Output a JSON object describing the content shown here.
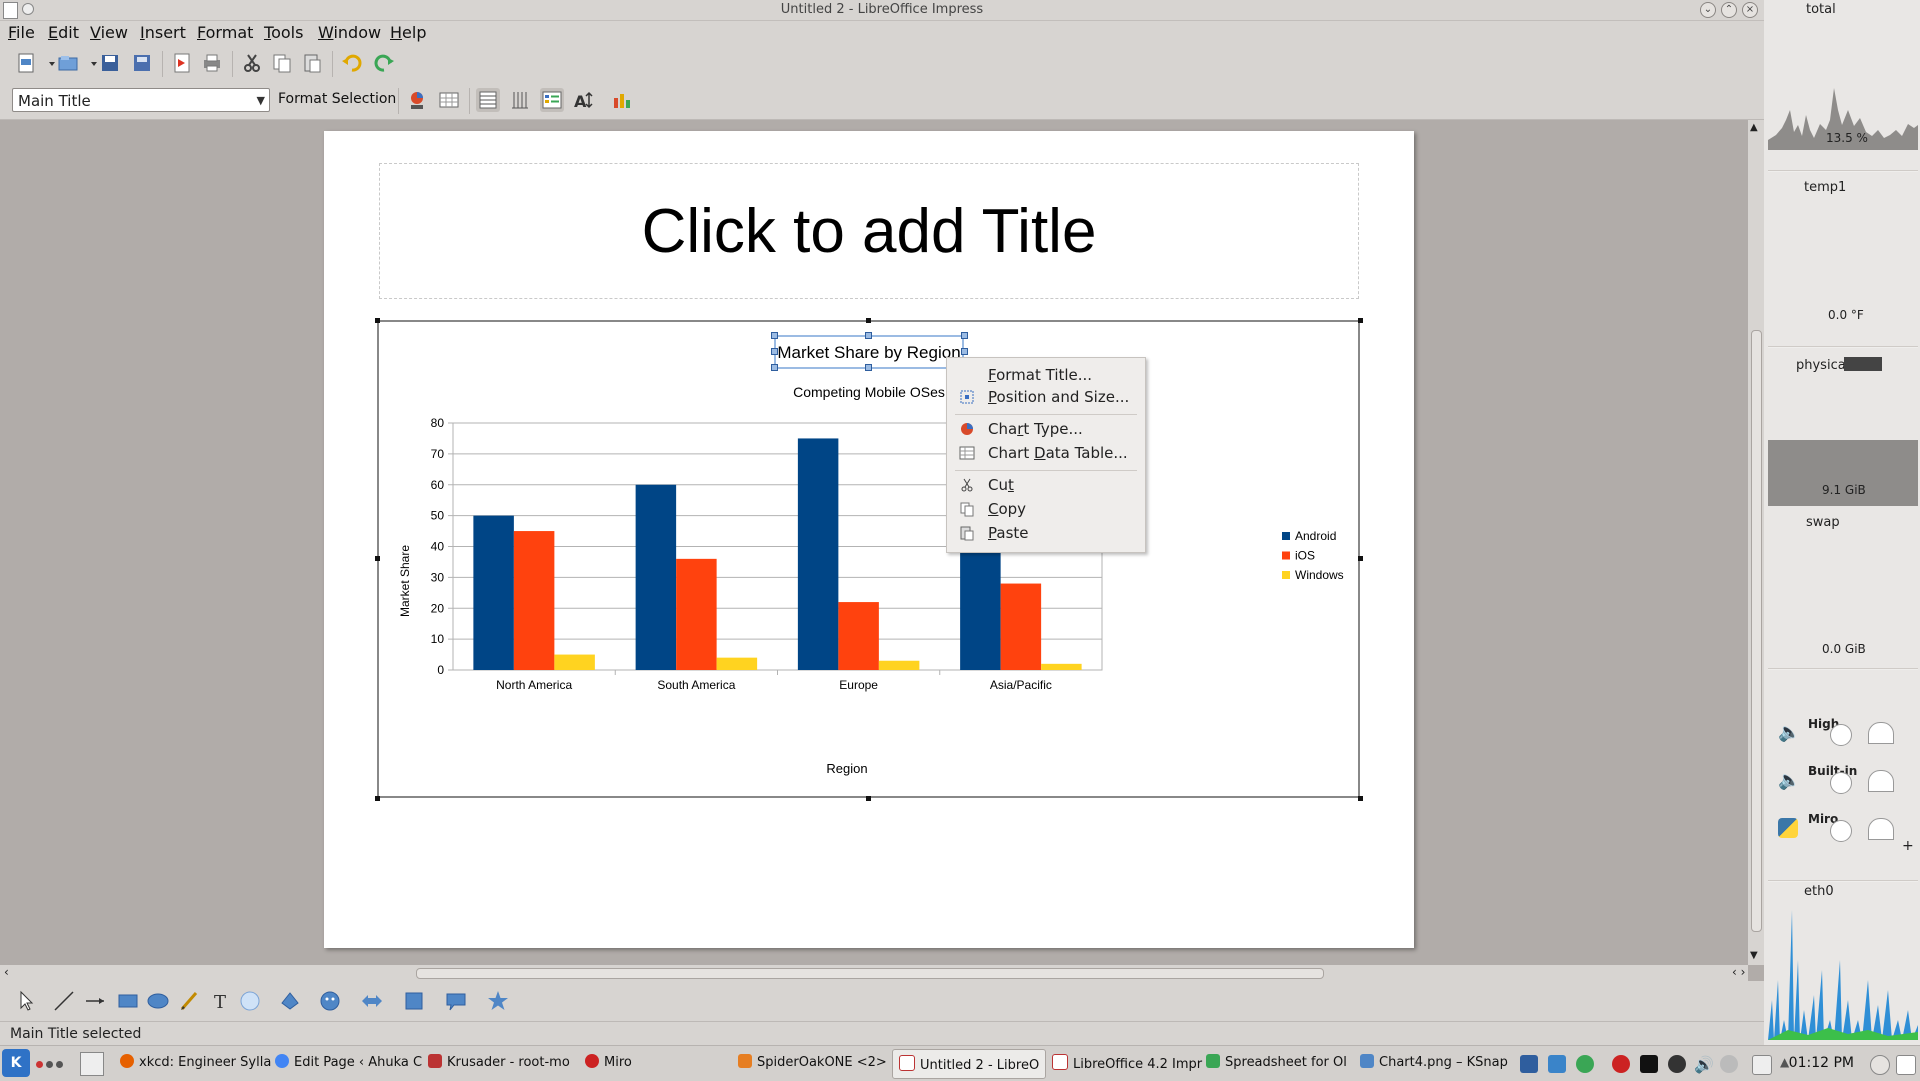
{
  "window": {
    "title": "Untitled 2 - LibreOffice Impress"
  },
  "menubar": [
    "File",
    "Edit",
    "View",
    "Insert",
    "Format",
    "Tools",
    "Window",
    "Help"
  ],
  "toolbar2": {
    "element_select": "Main Title",
    "format_selection": "Format Selection"
  },
  "slide": {
    "title_placeholder": "Click to add Title"
  },
  "chart_data": {
    "type": "bar",
    "title": "Market Share by Region",
    "subtitle": "Competing Mobile OSes",
    "xlabel": "Region",
    "ylabel": "Market Share",
    "categories": [
      "North America",
      "South America",
      "Europe",
      "Asia/Pacific"
    ],
    "series": [
      {
        "name": "Android",
        "values": [
          50,
          60,
          75,
          46
        ],
        "color": "#004586"
      },
      {
        "name": "iOS",
        "values": [
          45,
          36,
          22,
          28
        ],
        "color": "#ff420e"
      },
      {
        "name": "Windows",
        "values": [
          5,
          4,
          3,
          2
        ],
        "color": "#ffd320"
      }
    ],
    "ylim": [
      0,
      80
    ],
    "yticks": [
      0,
      10,
      20,
      30,
      40,
      50,
      60,
      70,
      80
    ],
    "grid": true,
    "legend": "right"
  },
  "context_menu": {
    "items": [
      {
        "label": "Format Title...",
        "mnemonic": 0
      },
      {
        "label": "Position and Size...",
        "mnemonic": 0
      },
      {
        "label": "Chart Type...",
        "mnemonic": 3
      },
      {
        "label": "Chart Data Table...",
        "mnemonic": 6
      },
      {
        "label": "Cut",
        "mnemonic": 2
      },
      {
        "label": "Copy",
        "mnemonic": 0
      },
      {
        "label": "Paste",
        "mnemonic": 0
      }
    ]
  },
  "statusbar": {
    "text": "Main Title selected"
  },
  "sysmon": {
    "total_label": "total",
    "cpu_value": "13.5 %",
    "temp_label": "temp1",
    "temp_value": "0.0 °F",
    "physical_label": "physical",
    "physical_value": "9.1 GiB",
    "swap_label": "swap",
    "swap_value": "0.0 GiB",
    "mixer": [
      "High",
      "Built-in",
      "Miro"
    ],
    "net_label": "eth0"
  },
  "taskbar": {
    "tasks": [
      "xkcd: Engineer Sylla",
      "Edit Page ‹ Ahuka C",
      "Krusader - root-mo",
      "Miro",
      "SpiderOakONE <2>",
      "Untitled 2 - LibreO",
      "LibreOffice 4.2 Impr",
      "Spreadsheet for Ol",
      "Chart4.png – KSnap"
    ],
    "clock": "01:12 PM"
  }
}
